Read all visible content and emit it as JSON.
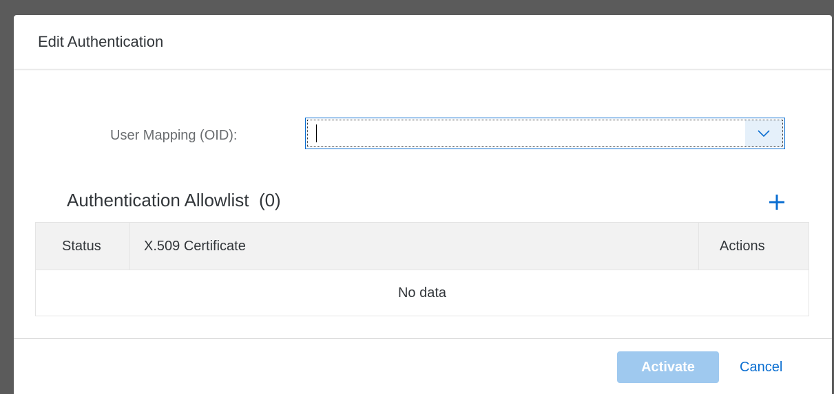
{
  "dialog": {
    "title": "Edit Authentication"
  },
  "form": {
    "user_mapping_label": "User Mapping (OID):",
    "user_mapping_value": "",
    "dropdown_icon": "chevron-down-icon"
  },
  "allowlist": {
    "title": "Authentication Allowlist",
    "count": "(0)",
    "add_icon": "plus-icon",
    "columns": [
      "Status",
      "X.509 Certificate",
      "Actions"
    ],
    "empty_text": "No data"
  },
  "footer": {
    "activate_label": "Activate",
    "cancel_label": "Cancel"
  },
  "colors": {
    "accent": "#0a6ed1",
    "disabled_button": "#9fc9ef"
  }
}
